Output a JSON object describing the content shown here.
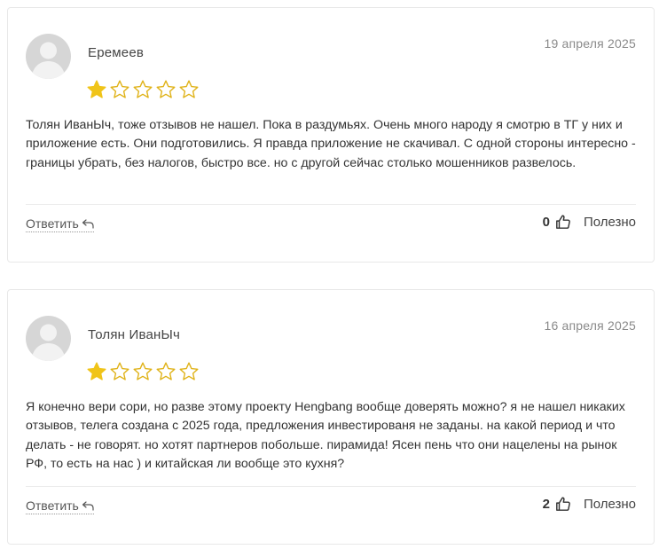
{
  "reviews": [
    {
      "author": "Еремеев",
      "date": "19 апреля 2025",
      "rating": 1,
      "max_rating": 5,
      "text": "Толян ИванЫч, тоже отзывов не нашел. Пока в раздумьях. Очень много народу я смотрю в ТГ у них и приложение есть. Они подготовились. Я правда приложение не скачивал. С одной стороны интересно - границы убрать, без налогов, быстро все. но с другой сейчас столько мошенников развелось.",
      "reply_label": "Ответить",
      "likes": "0",
      "useful_label": "Полезно"
    },
    {
      "author": "Толян ИванЫч",
      "date": "16 апреля 2025",
      "rating": 1,
      "max_rating": 5,
      "text": "Я конечно вери сори, но разве этому проекту Hengbang вообще доверять можно? я не нашел никаких отзывов, телега создана с 2025 года, предложения инвестированя не заданы. на какой период и что делать - не говорят. но хотят партнеров побольше. пирамида! Ясен пень что они нацелены на рынок РФ, то есть на нас ) и китайская ли вообще это кухня?",
      "reply_label": "Ответить",
      "likes": "2",
      "useful_label": "Полезно"
    }
  ],
  "colors": {
    "star_fill": "#f0c419",
    "star_outline": "#e0b31a"
  }
}
